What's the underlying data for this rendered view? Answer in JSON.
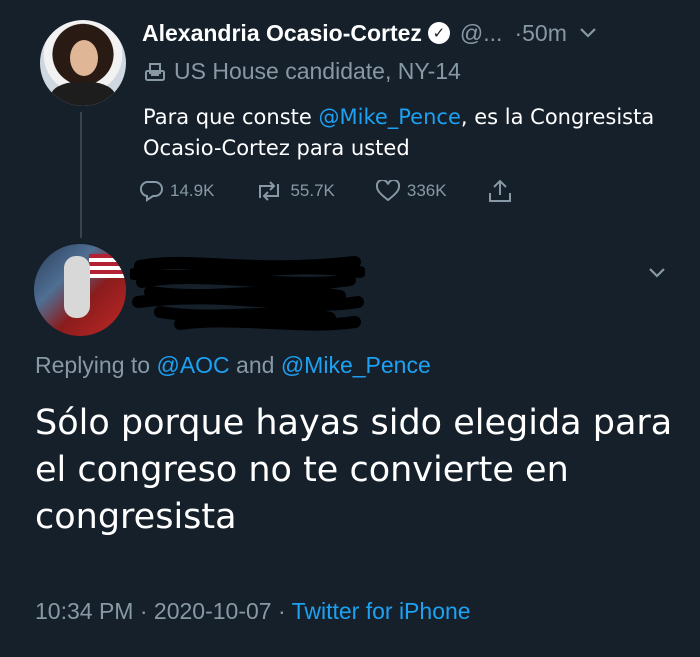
{
  "tweet1": {
    "author_name": "Alexandria Ocasio-Cortez",
    "handle": "@...",
    "separator": "·",
    "time": "50m",
    "label": "US House candidate, NY-14",
    "text_prefix": "Para que conste ",
    "mention": "@Mike_Pence",
    "text_suffix": ", es la Congresista Ocasio-Cortez para usted",
    "replies": "14.9K",
    "retweets": "55.7K",
    "likes": "336K"
  },
  "tweet2": {
    "replying_prefix": "Replying to ",
    "mention_1": "@AOC",
    "replying_and": " and ",
    "mention_2": "@Mike_Pence",
    "text": "Sólo porque hayas sido elegida para el congreso no te convierte en congresista",
    "time": "10:34 PM",
    "meta_separator": " · ",
    "date": "2020-10-07",
    "source": "Twitter for iPhone"
  },
  "colors": {
    "background": "#15202b",
    "accent": "#1da1f2",
    "secondary_text": "#8899a6"
  },
  "icons": [
    "verified-badge-icon",
    "chevron-down-icon",
    "ballot-box-icon",
    "reply-icon",
    "retweet-icon",
    "like-icon",
    "share-icon"
  ]
}
